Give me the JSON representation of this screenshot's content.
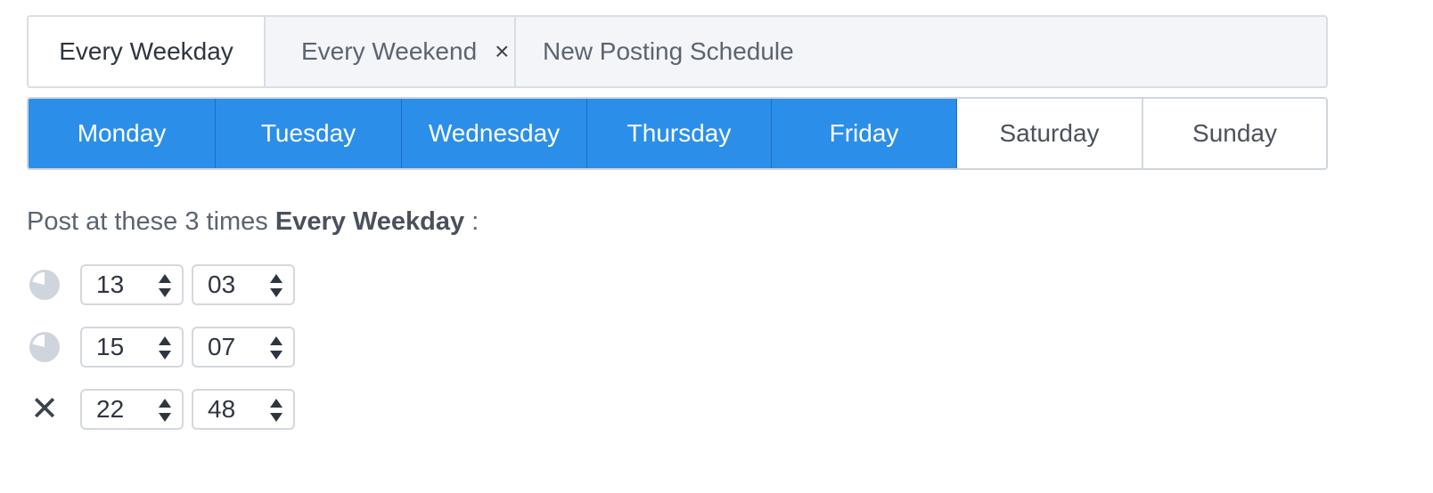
{
  "schedule_tabs": [
    {
      "label": "Every Weekday",
      "active": true
    },
    {
      "label": "Every Weekend",
      "close_glyph": "×"
    },
    {
      "label": "New Posting Schedule"
    }
  ],
  "days": [
    {
      "label": "Monday",
      "selected": true
    },
    {
      "label": "Tuesday",
      "selected": true
    },
    {
      "label": "Wednesday",
      "selected": true
    },
    {
      "label": "Thursday",
      "selected": true
    },
    {
      "label": "Friday",
      "selected": true
    },
    {
      "label": "Saturday",
      "selected": false
    },
    {
      "label": "Sunday",
      "selected": false
    }
  ],
  "heading": {
    "prefix": "Post at these 3 times",
    "schedule_name": "Every Weekday",
    "suffix": ":"
  },
  "times": [
    {
      "icon": "clock-icon",
      "hour": "13",
      "minute": "03"
    },
    {
      "icon": "clock-icon",
      "hour": "15",
      "minute": "07"
    },
    {
      "icon": "remove-icon",
      "remove_glyph": "✕",
      "hour": "22",
      "minute": "48"
    }
  ],
  "colors": {
    "accent": "#2b8fea",
    "tab_bg": "#f3f5f8",
    "icon_gray": "#cfd5dc"
  }
}
